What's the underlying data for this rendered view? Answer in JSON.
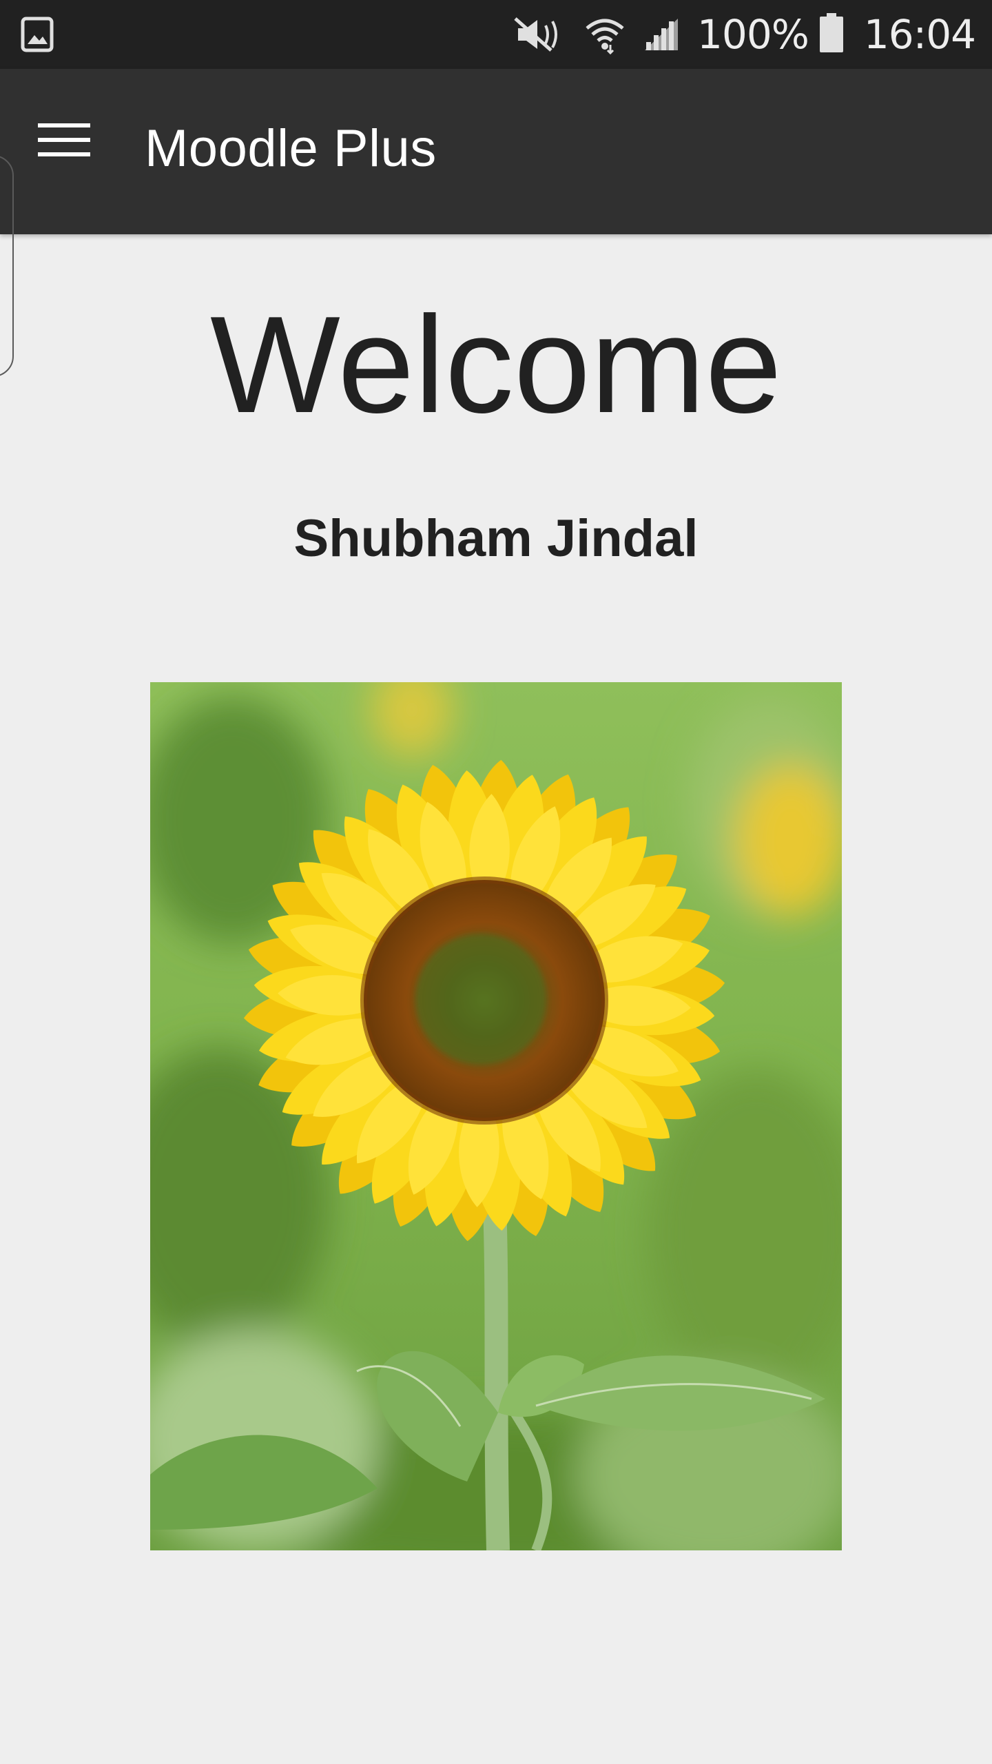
{
  "status_bar": {
    "battery_percent": "100%",
    "time": "16:04",
    "icons": [
      "gallery-icon",
      "mute-icon",
      "wifi-icon",
      "signal-icon",
      "battery-icon"
    ]
  },
  "app_bar": {
    "title": "Moodle Plus",
    "menu_icon": "hamburger-menu-icon",
    "background_color": "#303030"
  },
  "main": {
    "welcome": "Welcome",
    "user_name": "Shubham Jindal",
    "image": "sunflower-image"
  },
  "colors": {
    "status_bar": "#212121",
    "page_background": "#eeeeee",
    "text": "#212121"
  }
}
